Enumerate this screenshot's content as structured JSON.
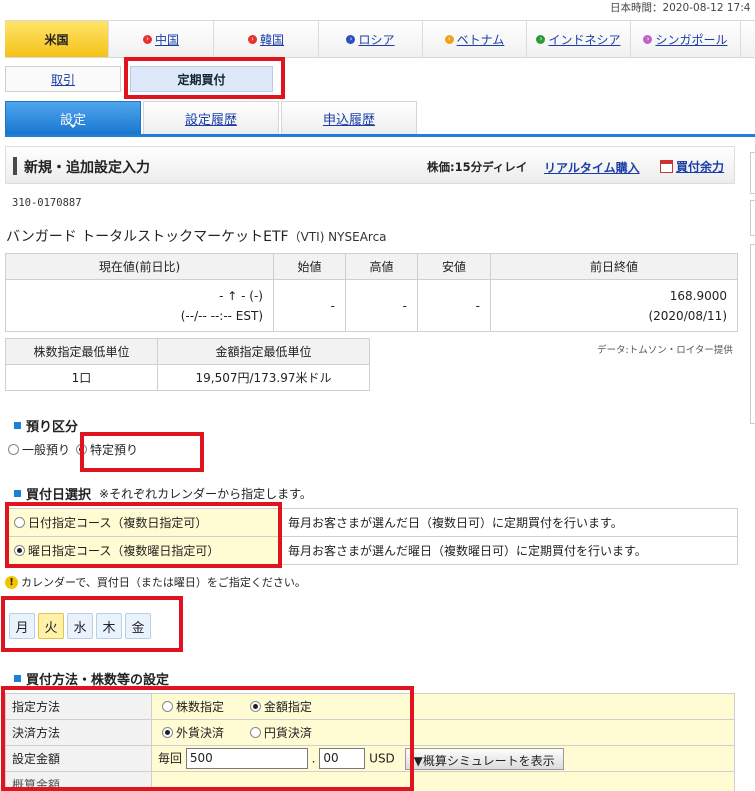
{
  "clock": "日本時間：2020-08-12 17:4",
  "markets": [
    {
      "label": "米国",
      "active": true,
      "dot": ""
    },
    {
      "label": "中国",
      "active": false,
      "dot": "#e8322e"
    },
    {
      "label": "韓国",
      "active": false,
      "dot": "#e8322e"
    },
    {
      "label": "ロシア",
      "active": false,
      "dot": "#2b4fc2"
    },
    {
      "label": "ベトナム",
      "active": false,
      "dot": "#f0a21a"
    },
    {
      "label": "インドネシア",
      "active": false,
      "dot": "#2c9a3a"
    },
    {
      "label": "シンガポール",
      "active": false,
      "dot": "#c060c8"
    }
  ],
  "sub_tabs": {
    "trade": "取引",
    "regular": "定期買付"
  },
  "section_tabs": {
    "settings": "設定",
    "history": "設定履歴",
    "applications": "申込履歴"
  },
  "header": {
    "title": "新規・追加設定入力",
    "price_note": "株価:15分ディレイ",
    "realtime_link": "リアルタイム購入",
    "buying_power": "買付余力"
  },
  "instrument": {
    "code": "310-0170887",
    "name": "バンガード トータルストックマーケットETF",
    "ticker": "（VTI) NYSEArca"
  },
  "quote": {
    "headers": [
      "現在値(前日比)",
      "始値",
      "高値",
      "安値",
      "前日終値"
    ],
    "current_line1": "- ↑ - (-)",
    "current_line2": "(--/-- --:-- EST)",
    "open": "-",
    "high": "-",
    "low": "-",
    "prev_close": "168.9000",
    "prev_close_date": "(2020/08/11)"
  },
  "minimums": {
    "headers": [
      "株数指定最低単位",
      "金額指定最低単位"
    ],
    "shares": "1口",
    "amount": "19,507円/173.97米ドル"
  },
  "data_source": "データ:トムソン・ロイター提供",
  "account": {
    "heading": "預り区分",
    "general": "一般預り",
    "specific": "特定預り"
  },
  "purchase_day": {
    "heading": "買付日選択",
    "note": "※それぞれカレンダーから指定します。",
    "date_course": "日付指定コース（複数日指定可）",
    "date_desc": "毎月お客さまが選んだ日（複数日可）に定期買付を行います。",
    "weekday_course": "曜日指定コース（複数曜日指定可）",
    "weekday_desc": "毎月お客さまが選んだ曜日（複数曜日可）に定期買付を行います。"
  },
  "calendar_warning": "カレンダーで、買付日（または曜日）をご指定ください。",
  "weekdays": [
    {
      "label": "月",
      "selected": false
    },
    {
      "label": "火",
      "selected": true
    },
    {
      "label": "水",
      "selected": false
    },
    {
      "label": "木",
      "selected": false
    },
    {
      "label": "金",
      "selected": false
    }
  ],
  "method": {
    "heading": "買付方法・株数等の設定",
    "spec_label": "指定方法",
    "spec_shares": "株数指定",
    "spec_amount": "金額指定",
    "settle_label": "決済方法",
    "settle_foreign": "外貨決済",
    "settle_yen": "円貨決済",
    "amount_label": "設定金額",
    "every_time": "毎回",
    "amount_int": "500",
    "amount_sep": ".",
    "amount_dec": "00",
    "currency": "USD",
    "simulate_button": "▼概算シミュレートを表示",
    "next_row_label": "概算金額"
  }
}
